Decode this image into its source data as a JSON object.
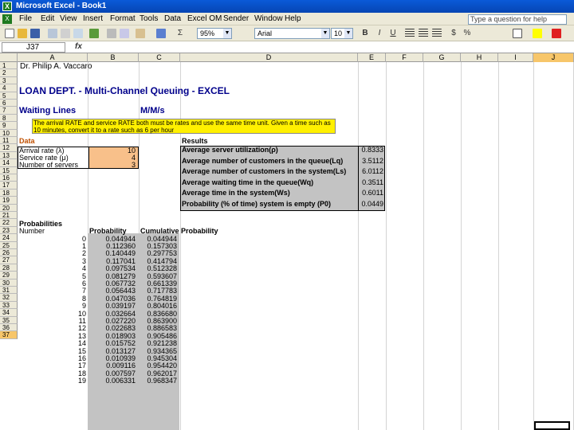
{
  "window": {
    "title": "Microsoft Excel - Book1"
  },
  "menu": [
    "File",
    "Edit",
    "View",
    "Insert",
    "Format",
    "Tools",
    "Data",
    "Excel OM",
    "Sender",
    "Window",
    "Help"
  ],
  "help_placeholder": "Type a question for help",
  "toolbar": {
    "zoom": "95%",
    "font": "Arial",
    "font_size": "10",
    "sum": "Σ",
    "bold": "B",
    "italic": "I",
    "underline": "U",
    "currency": "$",
    "percent": "%"
  },
  "formula_bar": {
    "name_box": "J37",
    "fx": "fx"
  },
  "columns": [
    "A",
    "B",
    "C",
    "D",
    "E",
    "F",
    "G",
    "H",
    "I",
    "J"
  ],
  "rows": [
    "1",
    "2",
    "3",
    "4",
    "5",
    "6",
    "7",
    "8",
    "9",
    "10",
    "11",
    "12",
    "13",
    "14",
    "15",
    "16",
    "17",
    "18",
    "19",
    "20",
    "21",
    "22",
    "23",
    "24",
    "25",
    "26",
    "27",
    "28",
    "29",
    "30",
    "31",
    "32",
    "33",
    "34",
    "35",
    "36",
    "37"
  ],
  "sheet": {
    "author": "Dr. Philip A. Vaccaro",
    "heading": "LOAN DEPT. - Multi-Channel Queuing - EXCEL",
    "section": "Waiting Lines",
    "model": "M/M/s",
    "note_line1": "The arrival RATE and service RATE both must be rates and use the same time unit. Given a time such as",
    "note_line2": "10 minutes, convert it to a rate such as 6 per hour",
    "data_label": "Data",
    "inputs": [
      {
        "label": "Arrival rate (λ)",
        "value": "10"
      },
      {
        "label": "Service rate (μ)",
        "value": "4"
      },
      {
        "label": "Number of servers",
        "value": "3"
      }
    ],
    "results_label": "Results",
    "results": [
      {
        "label": "Average server utilization(ρ)",
        "value": "0.8333"
      },
      {
        "label": "Average number of customers in the queue(Lq)",
        "value": "3.5112"
      },
      {
        "label": "Average number of customers in the system(Ls)",
        "value": "6.0112"
      },
      {
        "label": "Average waiting time in the queue(Wq)",
        "value": "0.3511"
      },
      {
        "label": "Average time in the system(Ws)",
        "value": "0.6011"
      },
      {
        "label": "Probability (% of time) system is empty (P0)",
        "value": "0.0449"
      }
    ],
    "prob_title": "Probabilities",
    "prob_headers": {
      "number": "Number",
      "probability": "Probability",
      "cumulative": "Cumulative Probability"
    },
    "prob_rows": [
      {
        "n": "0",
        "p": "0.044944",
        "c": "0.044944"
      },
      {
        "n": "1",
        "p": "0.112360",
        "c": "0.157303"
      },
      {
        "n": "2",
        "p": "0.140449",
        "c": "0.297753"
      },
      {
        "n": "3",
        "p": "0.117041",
        "c": "0.414794"
      },
      {
        "n": "4",
        "p": "0.097534",
        "c": "0.512328"
      },
      {
        "n": "5",
        "p": "0.081279",
        "c": "0.593607"
      },
      {
        "n": "6",
        "p": "0.067732",
        "c": "0.661339"
      },
      {
        "n": "7",
        "p": "0.056443",
        "c": "0.717783"
      },
      {
        "n": "8",
        "p": "0.047036",
        "c": "0.764819"
      },
      {
        "n": "9",
        "p": "0.039197",
        "c": "0.804016"
      },
      {
        "n": "10",
        "p": "0.032664",
        "c": "0.836680"
      },
      {
        "n": "11",
        "p": "0.027220",
        "c": "0.863900"
      },
      {
        "n": "12",
        "p": "0.022683",
        "c": "0.886583"
      },
      {
        "n": "13",
        "p": "0.018903",
        "c": "0.905486"
      },
      {
        "n": "14",
        "p": "0.015752",
        "c": "0.921238"
      },
      {
        "n": "15",
        "p": "0.013127",
        "c": "0.934365"
      },
      {
        "n": "16",
        "p": "0.010939",
        "c": "0.945304"
      },
      {
        "n": "17",
        "p": "0.009116",
        "c": "0.954420"
      },
      {
        "n": "18",
        "p": "0.007597",
        "c": "0.962017"
      },
      {
        "n": "19",
        "p": "0.006331",
        "c": "0.968347"
      }
    ]
  }
}
